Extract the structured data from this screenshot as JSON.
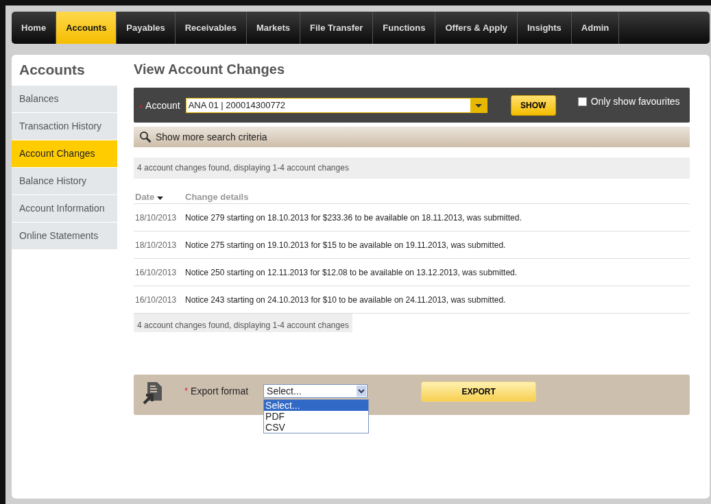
{
  "nav": [
    {
      "label": "Home",
      "selected": false
    },
    {
      "label": "Accounts",
      "selected": true
    },
    {
      "label": "Payables",
      "selected": false
    },
    {
      "label": "Receivables",
      "selected": false
    },
    {
      "label": "Markets",
      "selected": false
    },
    {
      "label": "File Transfer",
      "selected": false
    },
    {
      "label": "Functions",
      "selected": false
    },
    {
      "label": "Offers & Apply",
      "selected": false
    },
    {
      "label": "Insights",
      "selected": false
    },
    {
      "label": "Admin",
      "selected": false
    }
  ],
  "sidebar": {
    "title": "Accounts",
    "items": [
      {
        "label": "Balances",
        "selected": false
      },
      {
        "label": "Transaction History",
        "selected": false
      },
      {
        "label": "Account Changes",
        "selected": true
      },
      {
        "label": "Balance History",
        "selected": false
      },
      {
        "label": "Account Information",
        "selected": false
      },
      {
        "label": "Online Statements",
        "selected": false
      }
    ]
  },
  "page_title": "View Account Changes",
  "search": {
    "required_mark": "*",
    "account_label": "Account",
    "account_value": "ANA 01 | 200014300772",
    "show_button": "SHOW",
    "favourites": {
      "label": "Only show favourites",
      "checked": false
    },
    "more_criteria": "Show more search criteria"
  },
  "summary_top": "4 account changes found, displaying 1-4 account changes",
  "table": {
    "columns": [
      "Date",
      "Change details"
    ],
    "rows": [
      {
        "date": "18/10/2013",
        "details": "Notice 279 starting on 18.10.2013 for $233.36 to be available on 18.11.2013, was submitted."
      },
      {
        "date": "18/10/2013",
        "details": "Notice 275 starting on 19.10.2013 for $15 to be available on 19.11.2013, was submitted."
      },
      {
        "date": "16/10/2013",
        "details": "Notice 250 starting on 12.11.2013 for $12.08 to be available on 13.12.2013, was submitted."
      },
      {
        "date": "16/10/2013",
        "details": "Notice 243 starting on 24.10.2013 for $10 to be available on 24.11.2013, was submitted."
      }
    ]
  },
  "summary_bottom": "4 account changes found, displaying 1-4 account changes",
  "export": {
    "required_mark": "*",
    "label": "Export format",
    "value": "Select...",
    "options": [
      {
        "label": "Select...",
        "selected": true
      },
      {
        "label": "PDF",
        "selected": false
      },
      {
        "label": "CSV",
        "selected": false
      }
    ],
    "button": "EXPORT"
  }
}
